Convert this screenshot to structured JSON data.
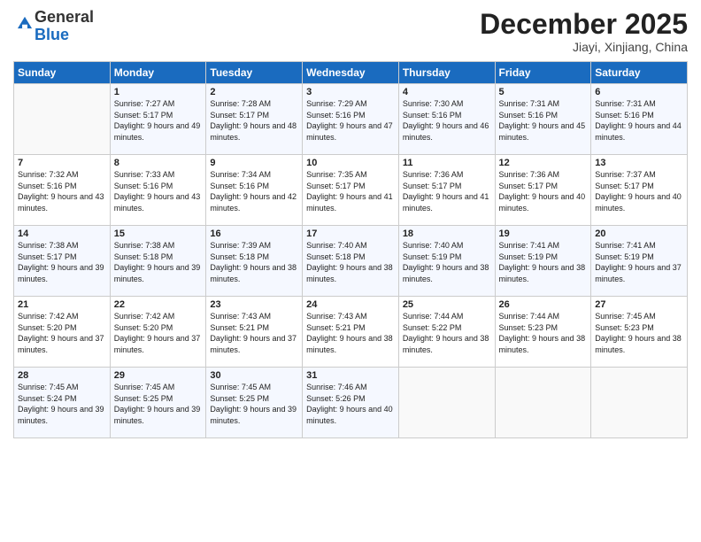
{
  "header": {
    "logo_general": "General",
    "logo_blue": "Blue",
    "month_title": "December 2025",
    "location": "Jiayi, Xinjiang, China"
  },
  "days_of_week": [
    "Sunday",
    "Monday",
    "Tuesday",
    "Wednesday",
    "Thursday",
    "Friday",
    "Saturday"
  ],
  "weeks": [
    [
      {
        "day": "",
        "sunrise": "",
        "sunset": "",
        "daylight": ""
      },
      {
        "day": "1",
        "sunrise": "Sunrise: 7:27 AM",
        "sunset": "Sunset: 5:17 PM",
        "daylight": "Daylight: 9 hours and 49 minutes."
      },
      {
        "day": "2",
        "sunrise": "Sunrise: 7:28 AM",
        "sunset": "Sunset: 5:17 PM",
        "daylight": "Daylight: 9 hours and 48 minutes."
      },
      {
        "day": "3",
        "sunrise": "Sunrise: 7:29 AM",
        "sunset": "Sunset: 5:16 PM",
        "daylight": "Daylight: 9 hours and 47 minutes."
      },
      {
        "day": "4",
        "sunrise": "Sunrise: 7:30 AM",
        "sunset": "Sunset: 5:16 PM",
        "daylight": "Daylight: 9 hours and 46 minutes."
      },
      {
        "day": "5",
        "sunrise": "Sunrise: 7:31 AM",
        "sunset": "Sunset: 5:16 PM",
        "daylight": "Daylight: 9 hours and 45 minutes."
      },
      {
        "day": "6",
        "sunrise": "Sunrise: 7:31 AM",
        "sunset": "Sunset: 5:16 PM",
        "daylight": "Daylight: 9 hours and 44 minutes."
      }
    ],
    [
      {
        "day": "7",
        "sunrise": "Sunrise: 7:32 AM",
        "sunset": "Sunset: 5:16 PM",
        "daylight": "Daylight: 9 hours and 43 minutes."
      },
      {
        "day": "8",
        "sunrise": "Sunrise: 7:33 AM",
        "sunset": "Sunset: 5:16 PM",
        "daylight": "Daylight: 9 hours and 43 minutes."
      },
      {
        "day": "9",
        "sunrise": "Sunrise: 7:34 AM",
        "sunset": "Sunset: 5:16 PM",
        "daylight": "Daylight: 9 hours and 42 minutes."
      },
      {
        "day": "10",
        "sunrise": "Sunrise: 7:35 AM",
        "sunset": "Sunset: 5:17 PM",
        "daylight": "Daylight: 9 hours and 41 minutes."
      },
      {
        "day": "11",
        "sunrise": "Sunrise: 7:36 AM",
        "sunset": "Sunset: 5:17 PM",
        "daylight": "Daylight: 9 hours and 41 minutes."
      },
      {
        "day": "12",
        "sunrise": "Sunrise: 7:36 AM",
        "sunset": "Sunset: 5:17 PM",
        "daylight": "Daylight: 9 hours and 40 minutes."
      },
      {
        "day": "13",
        "sunrise": "Sunrise: 7:37 AM",
        "sunset": "Sunset: 5:17 PM",
        "daylight": "Daylight: 9 hours and 40 minutes."
      }
    ],
    [
      {
        "day": "14",
        "sunrise": "Sunrise: 7:38 AM",
        "sunset": "Sunset: 5:17 PM",
        "daylight": "Daylight: 9 hours and 39 minutes."
      },
      {
        "day": "15",
        "sunrise": "Sunrise: 7:38 AM",
        "sunset": "Sunset: 5:18 PM",
        "daylight": "Daylight: 9 hours and 39 minutes."
      },
      {
        "day": "16",
        "sunrise": "Sunrise: 7:39 AM",
        "sunset": "Sunset: 5:18 PM",
        "daylight": "Daylight: 9 hours and 38 minutes."
      },
      {
        "day": "17",
        "sunrise": "Sunrise: 7:40 AM",
        "sunset": "Sunset: 5:18 PM",
        "daylight": "Daylight: 9 hours and 38 minutes."
      },
      {
        "day": "18",
        "sunrise": "Sunrise: 7:40 AM",
        "sunset": "Sunset: 5:19 PM",
        "daylight": "Daylight: 9 hours and 38 minutes."
      },
      {
        "day": "19",
        "sunrise": "Sunrise: 7:41 AM",
        "sunset": "Sunset: 5:19 PM",
        "daylight": "Daylight: 9 hours and 38 minutes."
      },
      {
        "day": "20",
        "sunrise": "Sunrise: 7:41 AM",
        "sunset": "Sunset: 5:19 PM",
        "daylight": "Daylight: 9 hours and 37 minutes."
      }
    ],
    [
      {
        "day": "21",
        "sunrise": "Sunrise: 7:42 AM",
        "sunset": "Sunset: 5:20 PM",
        "daylight": "Daylight: 9 hours and 37 minutes."
      },
      {
        "day": "22",
        "sunrise": "Sunrise: 7:42 AM",
        "sunset": "Sunset: 5:20 PM",
        "daylight": "Daylight: 9 hours and 37 minutes."
      },
      {
        "day": "23",
        "sunrise": "Sunrise: 7:43 AM",
        "sunset": "Sunset: 5:21 PM",
        "daylight": "Daylight: 9 hours and 37 minutes."
      },
      {
        "day": "24",
        "sunrise": "Sunrise: 7:43 AM",
        "sunset": "Sunset: 5:21 PM",
        "daylight": "Daylight: 9 hours and 38 minutes."
      },
      {
        "day": "25",
        "sunrise": "Sunrise: 7:44 AM",
        "sunset": "Sunset: 5:22 PM",
        "daylight": "Daylight: 9 hours and 38 minutes."
      },
      {
        "day": "26",
        "sunrise": "Sunrise: 7:44 AM",
        "sunset": "Sunset: 5:23 PM",
        "daylight": "Daylight: 9 hours and 38 minutes."
      },
      {
        "day": "27",
        "sunrise": "Sunrise: 7:45 AM",
        "sunset": "Sunset: 5:23 PM",
        "daylight": "Daylight: 9 hours and 38 minutes."
      }
    ],
    [
      {
        "day": "28",
        "sunrise": "Sunrise: 7:45 AM",
        "sunset": "Sunset: 5:24 PM",
        "daylight": "Daylight: 9 hours and 39 minutes."
      },
      {
        "day": "29",
        "sunrise": "Sunrise: 7:45 AM",
        "sunset": "Sunset: 5:25 PM",
        "daylight": "Daylight: 9 hours and 39 minutes."
      },
      {
        "day": "30",
        "sunrise": "Sunrise: 7:45 AM",
        "sunset": "Sunset: 5:25 PM",
        "daylight": "Daylight: 9 hours and 39 minutes."
      },
      {
        "day": "31",
        "sunrise": "Sunrise: 7:46 AM",
        "sunset": "Sunset: 5:26 PM",
        "daylight": "Daylight: 9 hours and 40 minutes."
      },
      {
        "day": "",
        "sunrise": "",
        "sunset": "",
        "daylight": ""
      },
      {
        "day": "",
        "sunrise": "",
        "sunset": "",
        "daylight": ""
      },
      {
        "day": "",
        "sunrise": "",
        "sunset": "",
        "daylight": ""
      }
    ]
  ]
}
